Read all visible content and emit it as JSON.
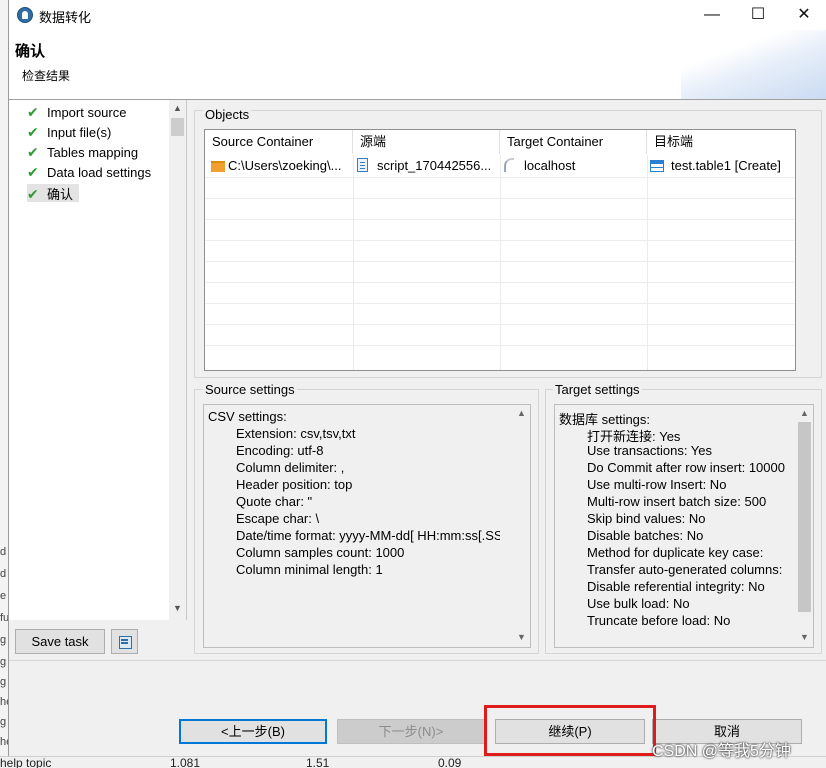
{
  "window": {
    "title": "数据转化",
    "minimize_glyph": "—",
    "maximize_glyph": "☐",
    "close_glyph": "✕"
  },
  "header": {
    "title": "确认",
    "subtitle": "检查结果"
  },
  "nav": {
    "items": [
      {
        "label": "Import source",
        "status": "done"
      },
      {
        "label": "Input file(s)",
        "status": "done"
      },
      {
        "label": "Tables mapping",
        "status": "done"
      },
      {
        "label": "Data load settings",
        "status": "done"
      },
      {
        "label": "确认",
        "status": "current"
      }
    ],
    "check_glyph": "✔"
  },
  "objects": {
    "group_label": "Objects",
    "columns": [
      "Source Container",
      "源端",
      "Target Container",
      "目标端"
    ],
    "rows": [
      {
        "source_container": "C:\\Users\\zoeking\\...",
        "source": "script_170442556...",
        "target_container": "localhost",
        "target": "test.table1 [Create]"
      }
    ]
  },
  "source_settings": {
    "group_label": "Source settings",
    "heading": "CSV settings:",
    "lines": [
      "Extension: csv,tsv,txt",
      "Encoding: utf-8",
      "Column delimiter: ,",
      "Header position: top",
      "Quote char: \"",
      "Escape char: \\",
      "Date/time format: yyyy-MM-dd[ HH:mm:ss[.SS",
      "Column samples count: 1000",
      "Column minimal length: 1"
    ]
  },
  "target_settings": {
    "group_label": "Target settings",
    "heading": "数据库 settings:",
    "lines": [
      "打开新连接: Yes",
      "Use transactions: Yes",
      "Do Commit after row insert: 10000",
      "Use multi-row Insert: No",
      "Multi-row insert batch size: 500",
      "Skip bind values: No",
      "Disable batches: No",
      "Method for duplicate key case:",
      "Transfer auto-generated columns: ",
      "Disable referential integrity: No",
      "Use bulk load: No",
      "Truncate before load: No"
    ]
  },
  "buttons": {
    "save_task": "Save task",
    "back": "<上一步(B)",
    "next": "下一步(N)>",
    "continue": "继续(P)",
    "cancel": "取消"
  },
  "background": {
    "left_marks": [
      "d",
      "d",
      "e",
      "fu",
      "g",
      "g",
      "g",
      "he",
      "g",
      "he",
      "he"
    ],
    "bottom_row": {
      "label": "help topic",
      "v1": "1.081",
      "v2": "1.51",
      "v3": "0.09"
    }
  },
  "watermark": "CSDN @等我5分钟",
  "colors": {
    "check": "#2f9a32",
    "default_button_border": "#0078d7",
    "highlight_box": "#e01b1b",
    "folder_icon": "#f0a030",
    "table_icon": "#2a7fd0"
  }
}
